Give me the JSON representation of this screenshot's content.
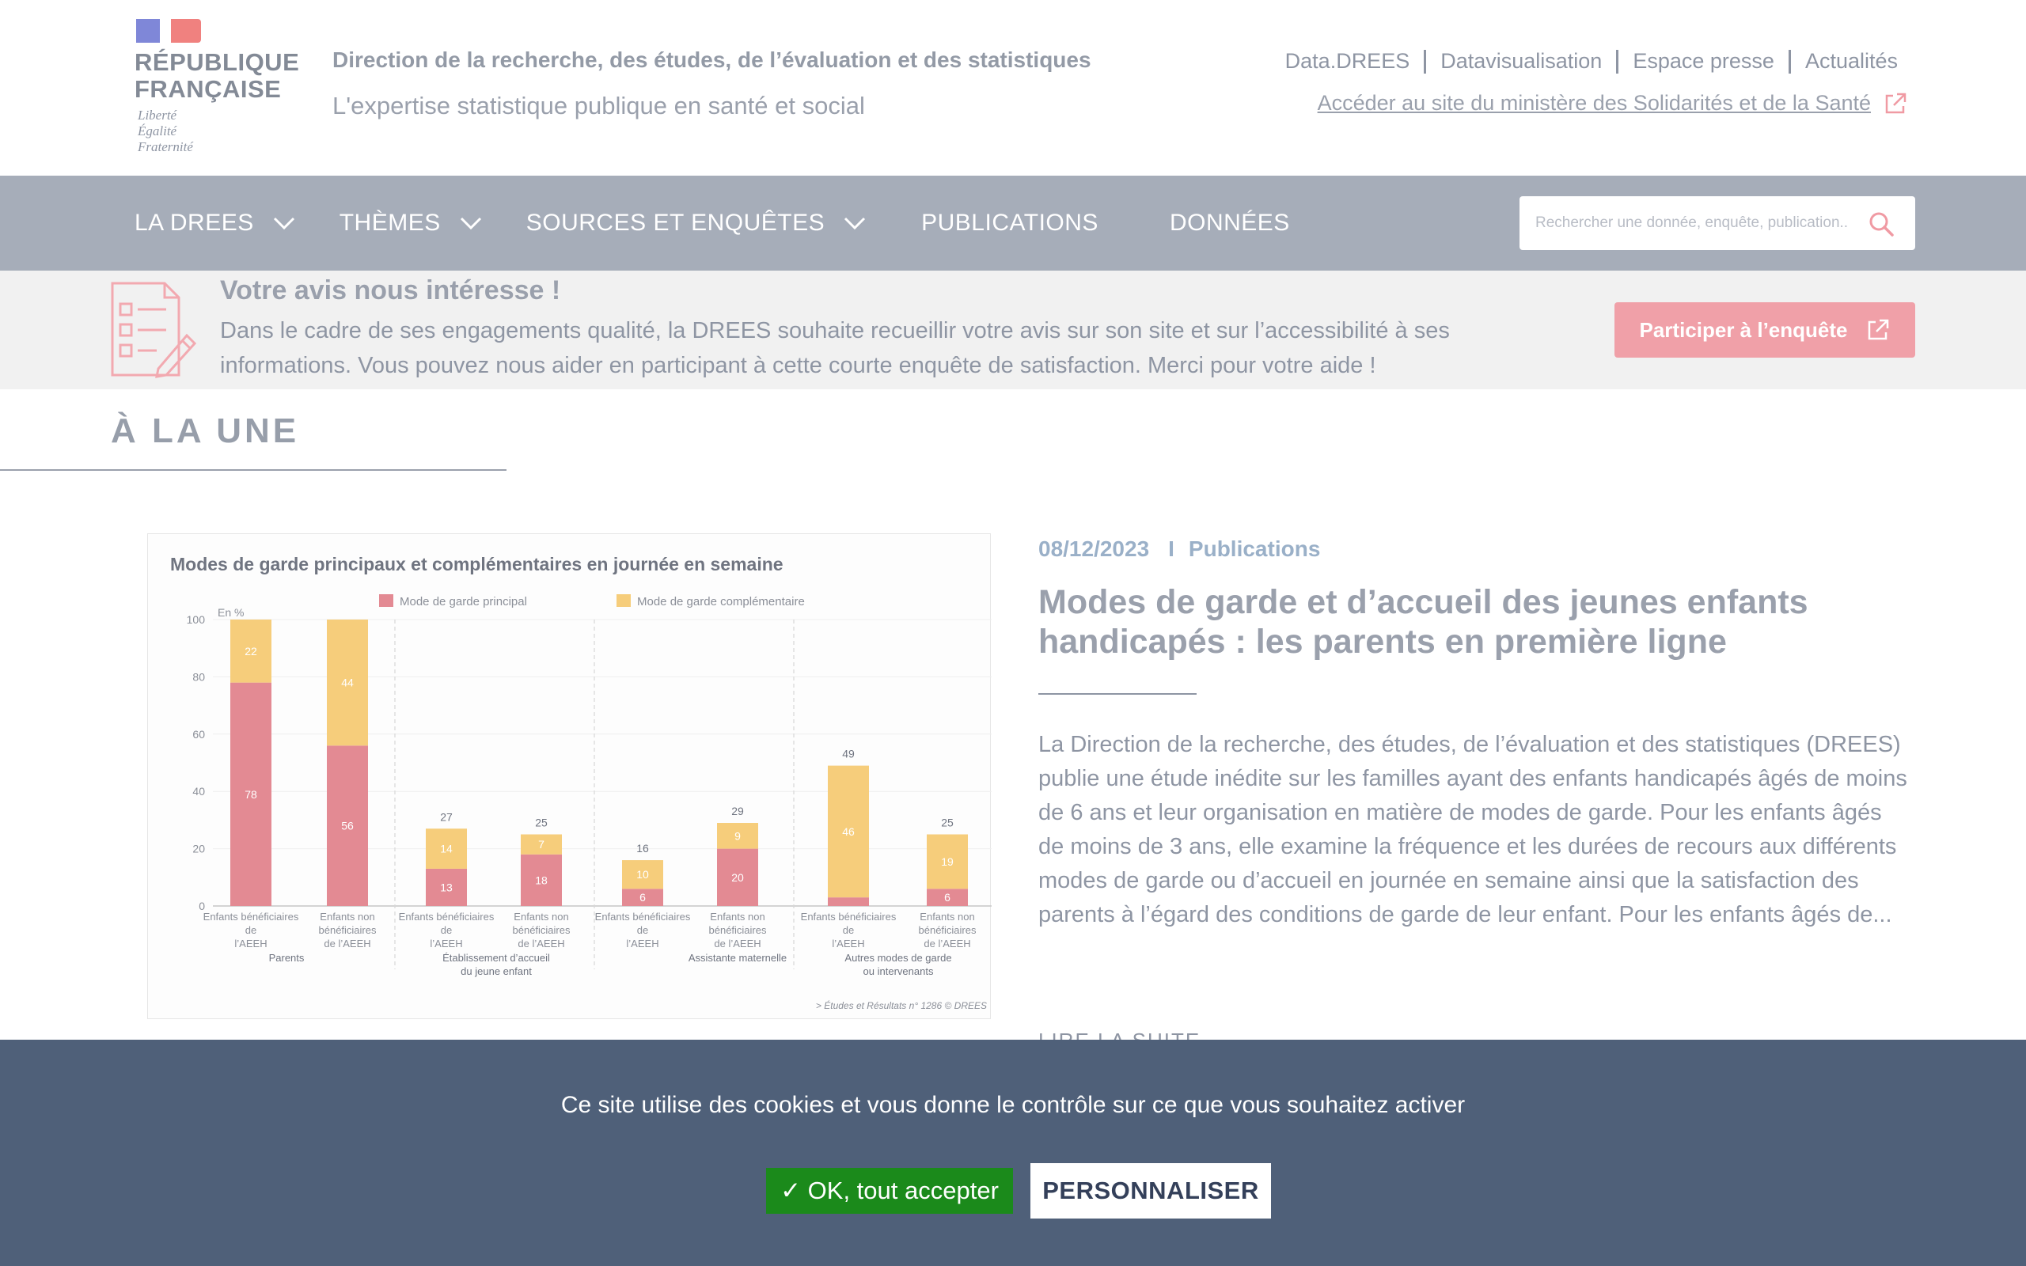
{
  "header": {
    "logo_lines": [
      "RÉPUBLIQUE",
      "FRANÇAISE"
    ],
    "motto": [
      "Liberté",
      "Égalité",
      "Fraternité"
    ],
    "title": "Direction de la recherche, des études, de l’évaluation et des statistiques",
    "subtitle": "L'expertise statistique publique en santé et social",
    "top_links": [
      "Data.DREES",
      "Datavisualisation",
      "Espace presse",
      "Actualités"
    ],
    "ministry_link": "Accéder au site du ministère des Solidarités et de la Santé"
  },
  "nav": {
    "items": [
      {
        "label": "LA DREES",
        "has_dropdown": true
      },
      {
        "label": "THÈMES",
        "has_dropdown": true
      },
      {
        "label": "SOURCES ET ENQUÊTES",
        "has_dropdown": true
      },
      {
        "label": "PUBLICATIONS",
        "has_dropdown": false
      },
      {
        "label": "DONNÉES",
        "has_dropdown": false
      }
    ],
    "search_placeholder": "Rechercher une donnée, enquête, publication..."
  },
  "survey": {
    "title": "Votre avis nous intéresse !",
    "text": "Dans le cadre de ses engagements qualité, la DREES souhaite recueillir votre avis sur son site et sur l’accessibilité à ses informations. Vous pouvez nous aider en participant à cette courte enquête de satisfaction. Merci pour votre aide !",
    "button": "Participer à l’enquête"
  },
  "une": {
    "title": "À LA UNE"
  },
  "article": {
    "date": "08/12/2023",
    "separator": "I",
    "category": "Publications",
    "title": "Modes de garde et d’accueil des jeunes enfants handicapés : les parents en première ligne",
    "body": "La Direction de la recherche, des études, de l’évaluation et des statistiques (DREES) publie une étude inédite sur les familles ayant des enfants handicapés âgés de moins de 6 ans et leur organisation en matière de modes de garde. Pour les enfants âgés de moins de 3 ans, elle examine la fréquence et les durées de recours aux différents modes de garde ou d’accueil en journée en semaine ainsi que la satisfaction des parents à l’égard des conditions de garde de leur enfant. Pour les enfants âgés de...",
    "read_more": "LIRE LA SUITE"
  },
  "chart_data": {
    "type": "bar",
    "title": "Modes de garde principaux et complémentaires en journée en semaine",
    "ylabel": "En %",
    "ylim": [
      0,
      100
    ],
    "yticks": [
      0,
      20,
      40,
      60,
      80,
      100
    ],
    "categories": [
      "Enfants bénéficiaires de l’AEEH",
      "Enfants non bénéficiaires de l’AEEH",
      "Enfants bénéficiaires de l’AEEH",
      "Enfants non bénéficiaires de l’AEEH",
      "Enfants bénéficiaires de l’AEEH",
      "Enfants non bénéficiaires de l’AEEH",
      "Enfants bénéficiaires de l’AEEH",
      "Enfants non bénéficiaires de l’AEEH"
    ],
    "groups": [
      "Parents",
      "Établissement d’accueil du jeune enfant",
      "Assistante maternelle",
      "Autres modes de garde ou intervenants"
    ],
    "series": [
      {
        "name": "Mode de garde principal",
        "color": "#e38a93",
        "values": [
          78,
          56,
          13,
          18,
          6,
          20,
          3,
          6
        ]
      },
      {
        "name": "Mode de garde complémentaire",
        "color": "#f6cd7b",
        "values": [
          22,
          44,
          14,
          7,
          10,
          9,
          46,
          19
        ]
      }
    ],
    "totals": [
      null,
      null,
      27,
      25,
      16,
      29,
      49,
      25
    ],
    "source": "> Études et Résultats n° 1286 © DREES"
  },
  "cookie": {
    "text": "Ce site utilise des cookies et vous donne le contrôle sur ce que vous souhaitez activer",
    "accept": "✓ OK, tout accepter",
    "customize": "PERSONNALISER"
  },
  "colors": {
    "nav_bg": "#a6adb9",
    "survey_button": "#f0a0a8",
    "cookie_bg": "#4f6079",
    "accept_button": "#1b8a1b"
  }
}
